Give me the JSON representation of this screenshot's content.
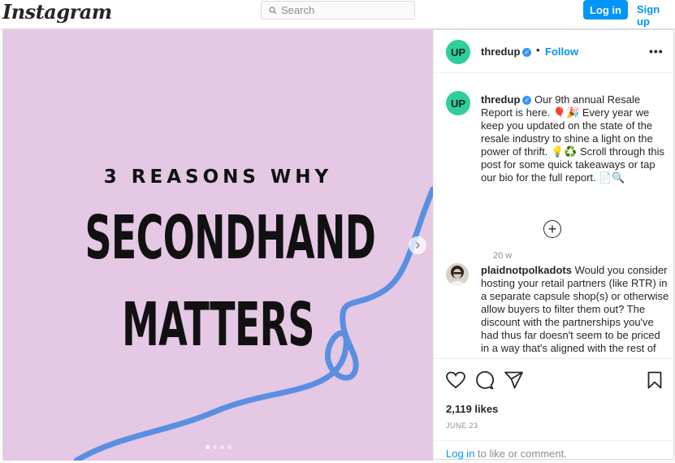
{
  "header": {
    "logo": "Instagram",
    "search_placeholder": "Search",
    "login_label": "Log in",
    "signup_label": "Sign up"
  },
  "post_image": {
    "subtitle": "3 REASONS WHY",
    "title_line1": "SECONDHAND",
    "title_line2": "MATTERS",
    "slide_count": 4,
    "active_slide": 1
  },
  "sidebar": {
    "author": {
      "avatar_text": "UP",
      "username": "thredup",
      "separator": "•",
      "follow_label": "Follow",
      "more": "•••"
    },
    "caption": {
      "username": "thredup",
      "text": "Our 9th annual Resale Report is here. 🎈🎉 Every year we keep you updated on the state of the resale industry to shine a light on the power of thrift. 💡♻️ Scroll through this post for some quick takeaways or tap our bio for the full report. 📄🔍",
      "time": "20 w"
    },
    "load_more": "+",
    "comment": {
      "username": "plaidnotpolkadots",
      "text": "Would you consider hosting your retail partners (like RTR) in a separate capsule shop(s) or otherwise allow buyers to filter them out? The discount with the partnerships you've had thus far doesn't seem to be priced in a way that's aligned with the rest of your"
    },
    "likes": "2,119 likes",
    "date": "JUNE 23",
    "login_link": "Log in",
    "login_suffix": " to like or comment."
  },
  "colors": {
    "accent": "#0095f6",
    "image_bg": "#e4c8e4",
    "ribbon": "#5a8fe0",
    "avatar_green": "#2fce9b"
  }
}
